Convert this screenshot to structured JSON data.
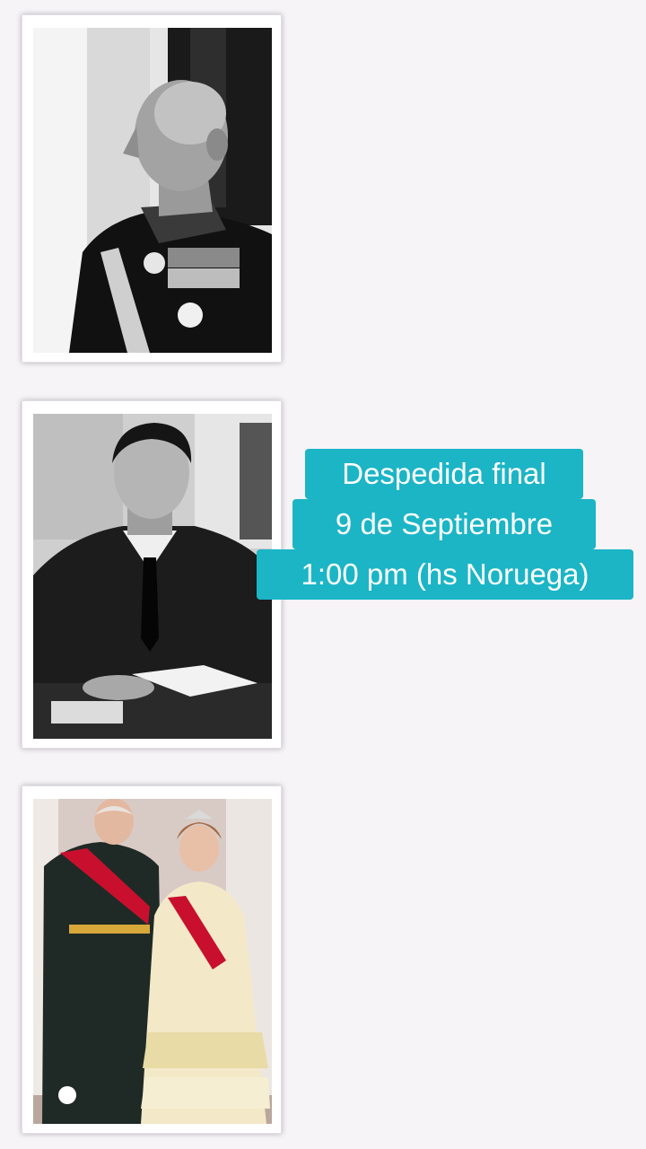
{
  "photos": [
    {
      "subject": "portrait-elderly-man-uniform",
      "style": "black-and-white"
    },
    {
      "subject": "portrait-young-man-desk",
      "style": "black-and-white"
    },
    {
      "subject": "royal-couple-formal-portrait",
      "style": "color"
    }
  ],
  "caption": {
    "line1": "Despedida final",
    "line2": "9 de Septiembre",
    "line3": "1:00 pm (hs Noruega)"
  },
  "colors": {
    "background": "#f6f4f7",
    "caption_bg": "#1bb5c6",
    "caption_text": "#ffffff",
    "card_border": "#ffffff"
  }
}
